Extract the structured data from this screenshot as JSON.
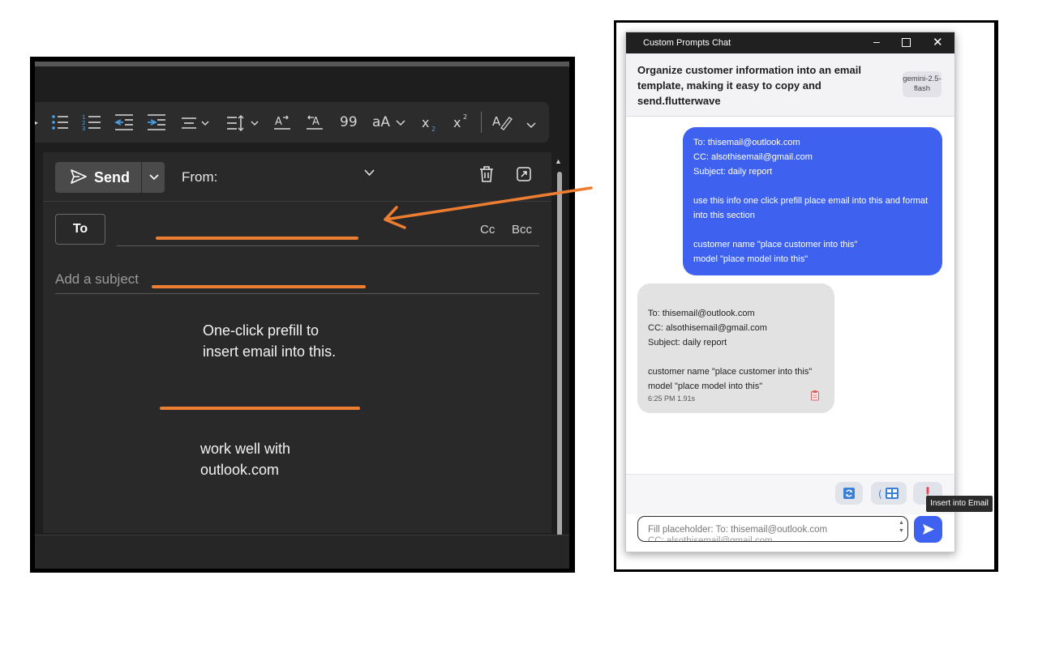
{
  "outlook": {
    "toolbar_icons": [
      "bullets-icon",
      "numbering-icon",
      "decrease-indent-icon",
      "increase-indent-icon",
      "align-icon",
      "line-spacing-icon",
      "paragraph-ltr-icon",
      "paragraph-rtl-icon",
      "quote-icon",
      "font-case-icon",
      "subscript-icon",
      "superscript-icon",
      "styles-icon",
      "more-icon"
    ],
    "send_label": "Send",
    "from_label": "From:",
    "to_label": "To",
    "cc_label": "Cc",
    "bcc_label": "Bcc",
    "subject_placeholder": "Add a subject",
    "quote_glyph": "99",
    "font_case_glyph": "aA"
  },
  "annotations": {
    "note1": "One-click prefill to insert email into this.",
    "note2": "work well with outlook.com",
    "accent_color": "#ed7d31"
  },
  "chat": {
    "window_title": "Custom Prompts Chat",
    "prompt_title": "Organize customer information into an email template, making it easy to copy and send.flutterwave",
    "model_badge": "gemini-2.5-flash",
    "user_message": "To: thisemail@outlook.com\nCC: alsothisemail@gmail.com\nSubject: daily report\n\nuse this info one click prefill  place email into this and format into this section\n\ncustomer name \"place customer into this\"\nmodel \"place model into this\"",
    "ai_message": "To: thisemail@outlook.com\nCC: alsothisemail@gmail.com\nSubject: daily report\n\ncustomer name \"place customer into this\"\nmodel \"place model into this\"",
    "ai_meta": "6:25 PM  1.91s",
    "tooltip": "Insert into Email",
    "input_value_line1": "Fill placeholder: To: thisemail@outlook.com",
    "input_value_line2": "CC: alsothisemail@gmail.com",
    "user_bubble_color": "#3e62ef",
    "ai_bubble_color": "#e2e2e2"
  }
}
